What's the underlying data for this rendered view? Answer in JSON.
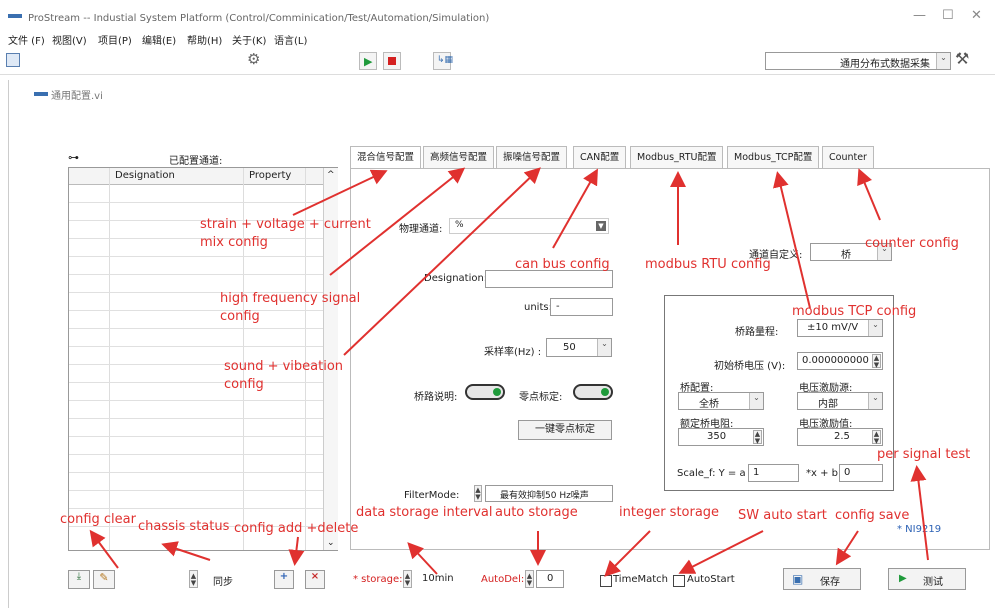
{
  "window": {
    "title": "ProStream -- Industial System Platform (Control/Comminication/Test/Automation/Simulation)",
    "min": "—",
    "max": "☐",
    "close": "✕"
  },
  "menu": [
    "文件 (F)",
    "视图(V)",
    "项目(P)",
    "编辑(E)",
    "帮助(H)",
    "关于(K)",
    "语言(L)"
  ],
  "toolbar": {
    "mode_select": "通用分布式数据采集"
  },
  "subwindow": {
    "title": "通用配置.vi"
  },
  "channels": {
    "title": "已配置通道:",
    "col_designation": "Designation",
    "col_property": "Property"
  },
  "tabs": [
    "混合信号配置",
    "高频信号配置",
    "振噪信号配置",
    "CAN配置",
    "Modbus_RTU配置",
    "Modbus_TCP配置",
    "Counter"
  ],
  "form": {
    "physical_channel_label": "物理通道:",
    "physical_channel_value": "%",
    "designation_label": "Designation:",
    "designation_value": "",
    "units_label": "units:",
    "units_value": "-",
    "sample_rate_label": "采样率(Hz) :",
    "sample_rate_value": "50",
    "bridge_desc_label": "桥路说明:",
    "zero_cal_label": "零点标定:",
    "one_key_zero": "一键零点标定",
    "filter_label": "FilterMode:",
    "filter_value": "最有效抑制50 Hz噪声",
    "custom_channel_label": "通道自定义:",
    "custom_channel_value": "桥",
    "device": "* NI9219"
  },
  "bridge": {
    "range_label": "桥路量程:",
    "range_value": "±10 mV/V",
    "init_voltage_label": "初始桥电压 (V):",
    "init_voltage_value": "0.000000000",
    "config_label": "桥配置:",
    "config_value": "全桥",
    "excitation_source_label": "电压激励源:",
    "excitation_source_value": "内部",
    "rated_resistance_label": "额定桥电阻:",
    "rated_resistance_value": "350",
    "excitation_value_label": "电压激励值:",
    "excitation_value": "2.5",
    "scale_label": "Scale_f:  Y = a",
    "scale_a": "1",
    "scale_mid": "*x +   b",
    "scale_b": "0"
  },
  "bottom": {
    "sync": "同步",
    "add": "+",
    "remove": "×",
    "storage_label": "* storage:",
    "storage_value": "10min",
    "autodel_label": "AutoDel:",
    "autodel_value": "0",
    "timematch": "TimeMatch",
    "autostart": "AutoStart",
    "save": "保存",
    "test": "测试"
  },
  "annotations": {
    "mix": "strain + voltage + current",
    "mix2": "mix config",
    "hf": "high frequency signal",
    "hf2": "config",
    "sv": "sound + vibeation",
    "sv2": "config",
    "can": "can bus config",
    "rtu": "modbus RTU config",
    "counter": "counter config",
    "tcp": "modbus TCP config",
    "per_test": "per signal test",
    "clear": "config clear",
    "chassis": "chassis status",
    "adddel": "config add +delete",
    "interval": "data storage interval",
    "autostore": "auto storage",
    "intstore": "integer storage",
    "swauto": "SW auto start",
    "save": "config save"
  },
  "colors": {
    "annotation": "#e0312f",
    "run_green": "#1f9a3b",
    "stop_red": "#d42020"
  }
}
